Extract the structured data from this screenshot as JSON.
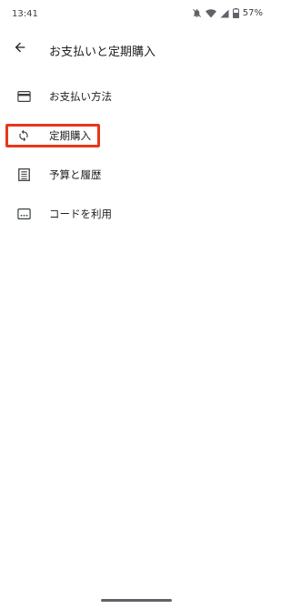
{
  "status_bar": {
    "time": "13:41",
    "battery": "57%"
  },
  "header": {
    "title": "お支払いと定期購入"
  },
  "menu": {
    "items": [
      {
        "label": "お支払い方法",
        "icon": "credit-card-icon"
      },
      {
        "label": "定期購入",
        "icon": "sync-icon",
        "highlighted": true
      },
      {
        "label": "予算と履歴",
        "icon": "list-icon"
      },
      {
        "label": "コードを利用",
        "icon": "redeem-code-icon"
      }
    ]
  },
  "colors": {
    "highlight": "#e8361c",
    "text": "#202124",
    "icon": "#3c4043"
  }
}
